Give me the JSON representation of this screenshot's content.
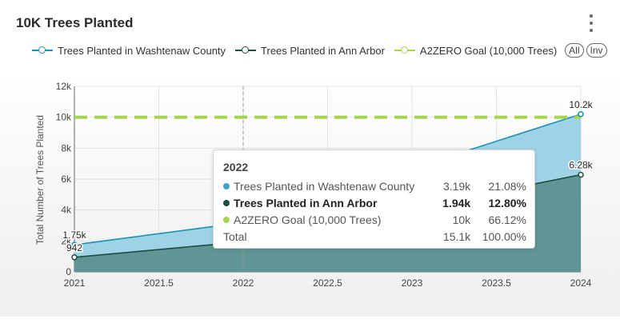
{
  "title": "10K Trees Planted",
  "legend": [
    {
      "name": "Trees Planted in Washtenaw County",
      "color": "#1a92b5"
    },
    {
      "name": "Trees Planted in Ann Arbor",
      "color": "#1e4d45"
    },
    {
      "name": "A2ZERO Goal (10,000 Trees)",
      "color": "#a7d54a"
    }
  ],
  "controls": {
    "all": "All",
    "inv": "Inv"
  },
  "chart_data": {
    "type": "area",
    "title": "10K Trees Planted",
    "xlabel": "",
    "ylabel": "Total Number of Trees Planted",
    "xlim": [
      2021,
      2024
    ],
    "ylim": [
      0,
      12000
    ],
    "x_ticks": [
      "2021",
      "2021.5",
      "2022",
      "2022.5",
      "2023",
      "2023.5",
      "2024"
    ],
    "y_ticks": [
      "0",
      "2k",
      "4k",
      "6k",
      "8k",
      "10k",
      "12k"
    ],
    "grid": true,
    "legend_position": "top-left",
    "series": [
      {
        "name": "Trees Planted in Washtenaw County",
        "x": [
          2021,
          2022,
          2024
        ],
        "y": [
          1750,
          3190,
          10200
        ],
        "end_labels": [
          "1.75k",
          "10.2k"
        ],
        "color": "#1a92b5",
        "fill": "#9ed3e6"
      },
      {
        "name": "Trees Planted in Ann Arbor",
        "x": [
          2021,
          2022,
          2024
        ],
        "y": [
          942,
          1940,
          6280
        ],
        "end_labels": [
          "942",
          "6.28k"
        ],
        "color": "#1e4d45",
        "fill": "#5f9594"
      },
      {
        "name": "A2ZERO Goal (10,000 Trees)",
        "x": [
          2021,
          2024
        ],
        "y": [
          10000,
          10000
        ],
        "color": "#a7d54a",
        "style": "dashed"
      }
    ],
    "crosshair_x": 2022
  },
  "tooltip": {
    "title": "2022",
    "rows": [
      {
        "name": "Trees Planted in Washtenaw County",
        "value": "3.19k",
        "pct": "21.08%",
        "color": "#3aa6c6"
      },
      {
        "name": "Trees Planted in Ann Arbor",
        "value": "1.94k",
        "pct": "12.80%",
        "color": "#1e4d45"
      },
      {
        "name": "A2ZERO Goal (10,000 Trees)",
        "value": "10k",
        "pct": "66.12%",
        "color": "#a7d54a"
      }
    ],
    "total": {
      "name": "Total",
      "value": "15.1k",
      "pct": "100.00%"
    }
  }
}
